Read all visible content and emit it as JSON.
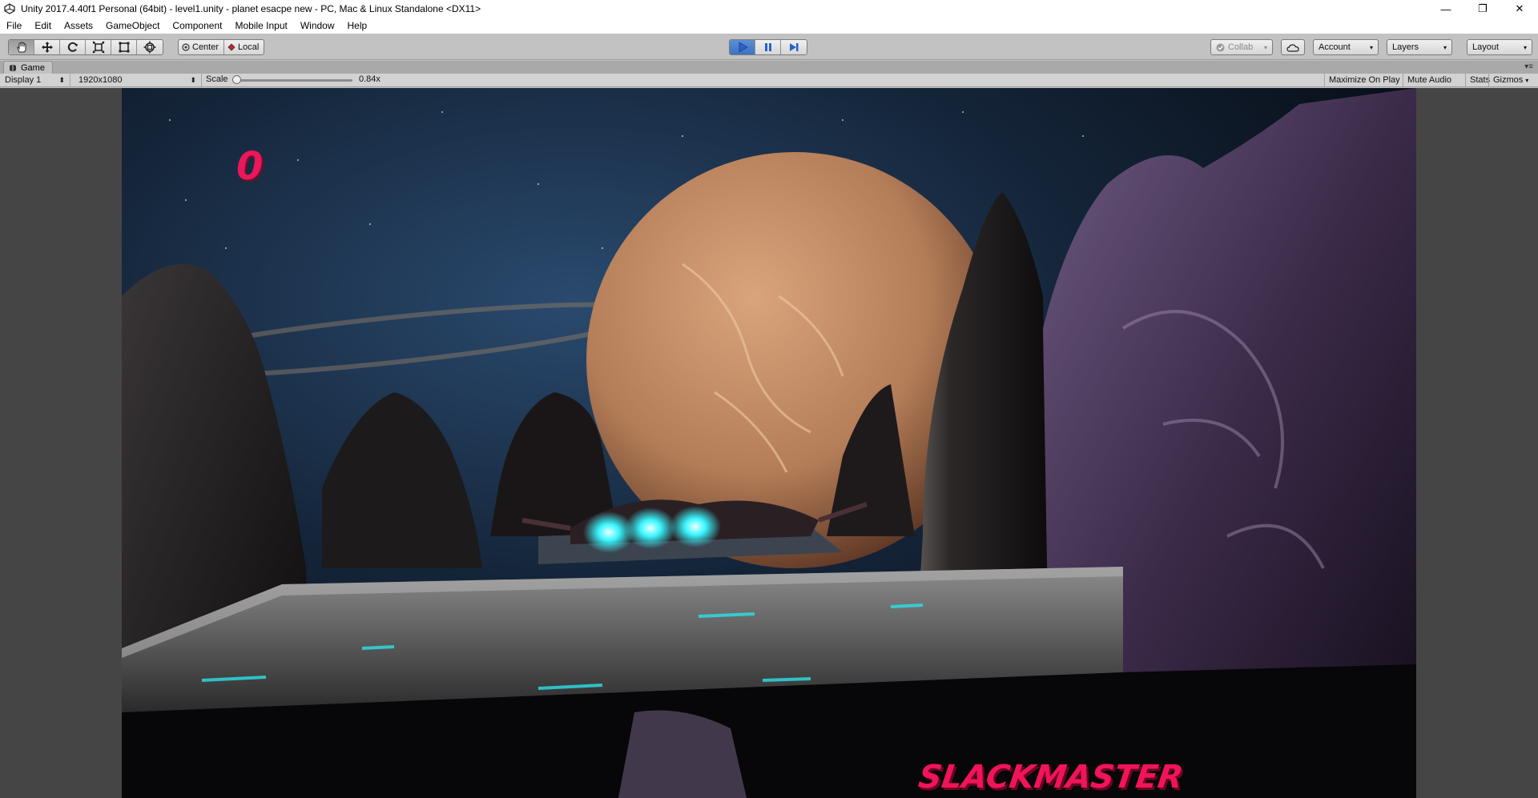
{
  "window": {
    "title": "Unity 2017.4.40f1 Personal (64bit) - level1.unity - planet esacpe new - PC, Mac & Linux Standalone <DX11>",
    "controls": {
      "minimize": "—",
      "restore": "❐",
      "close": "✕"
    }
  },
  "menu": [
    "File",
    "Edit",
    "Assets",
    "GameObject",
    "Component",
    "Mobile Input",
    "Window",
    "Help"
  ],
  "toolbar": {
    "transform_tools": [
      "hand-tool",
      "move-tool",
      "rotate-tool",
      "scale-tool",
      "rect-tool",
      "transform-tool"
    ],
    "pivot_label": "Center",
    "rotation_label": "Local",
    "play_state": "playing",
    "collab_label": "Collab",
    "account_label": "Account",
    "layers_label": "Layers",
    "layout_label": "Layout"
  },
  "game_tab": {
    "label": "Game",
    "display": "Display 1",
    "resolution": "1920x1080",
    "scale_label": "Scale",
    "scale_value": "0.84x",
    "scale_fraction": 0.0,
    "right_toggles": [
      "Maximize On Play",
      "Mute Audio",
      "Stats",
      "Gizmos"
    ]
  },
  "game": {
    "score": "0",
    "logo": "SLACKMASTER"
  },
  "colors": {
    "accent_pink": "#e8185b",
    "play_blue": "#3d72c2",
    "thruster_cyan": "#39f6ff"
  }
}
